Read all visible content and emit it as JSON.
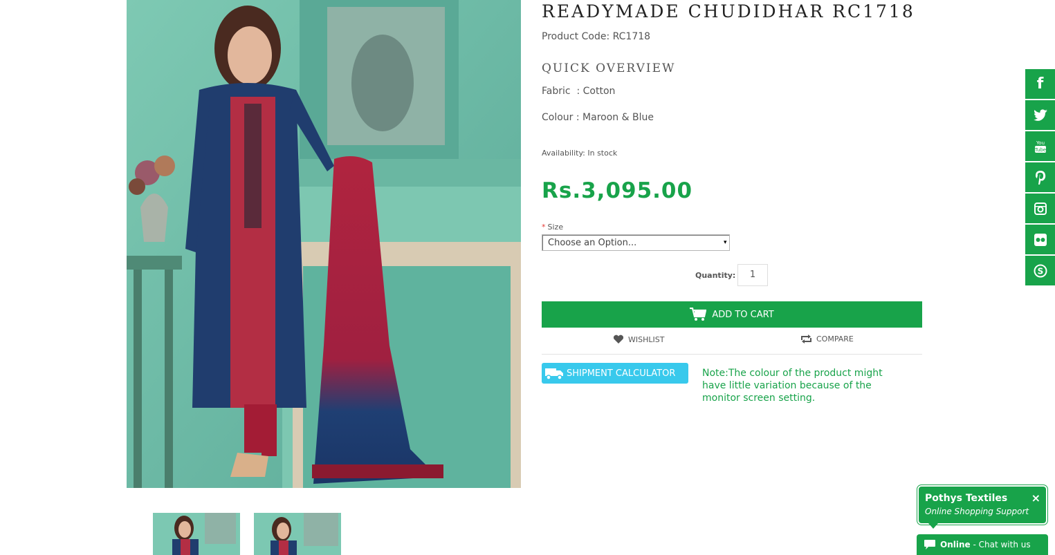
{
  "product": {
    "title": "READYMADE CHUDIDHAR RC1718",
    "code": "Product Code: RC1718",
    "overview_heading": "QUICK OVERVIEW",
    "fabric": "Fabric  : Cotton",
    "colour": "Colour : Maroon & Blue",
    "availability": "Availability: In stock",
    "price": "Rs.3,095.00"
  },
  "options": {
    "size_required": "*",
    "size_label": "Size",
    "size_value": "Choose an Option...",
    "quantity_label": "Quantity:",
    "quantity_value": "1"
  },
  "actions": {
    "add_to_cart": "ADD TO CART",
    "wishlist": "WISHLIST",
    "compare": "COMPARE",
    "shipment_calculator": "SHIPMENT CALCULATOR"
  },
  "note": "Note:The colour of the product might have little variation because of the monitor screen setting.",
  "social": [
    "facebook-icon",
    "twitter-icon",
    "youtube-icon",
    "pinterest-icon",
    "instagram-icon",
    "flickr-icon",
    "skype-icon"
  ],
  "chat": {
    "title": "Pothys Textiles",
    "subtitle": "Online Shopping Support",
    "close": "×",
    "status": "Online",
    "cta": " - Chat with us"
  },
  "colors": {
    "brand_green": "#18a34a",
    "shipment_blue": "#38c9ec"
  }
}
